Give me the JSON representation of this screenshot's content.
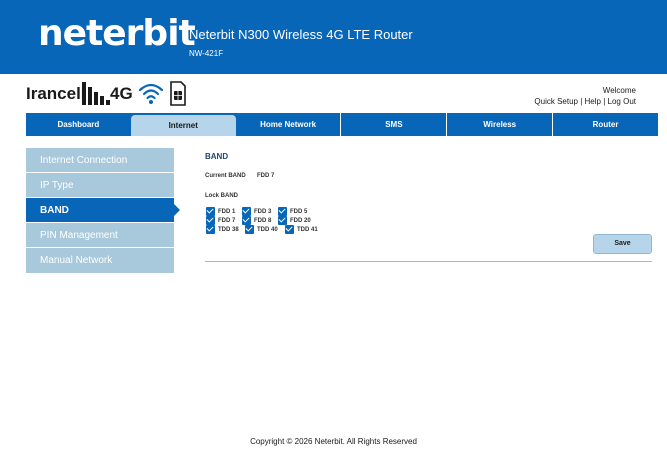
{
  "header": {
    "logo": "neterbit",
    "product_title": "Neterbit N300 Wireless 4G LTE Router",
    "model": "NW-421F"
  },
  "status": {
    "operator": "Irancell",
    "network_type": "4G",
    "signal_level": 5,
    "signal_max": 5
  },
  "user": {
    "welcome": "Welcome",
    "links": [
      "Quick Setup",
      "Help",
      "Log Out"
    ],
    "separator": "|"
  },
  "nav": [
    "Dashboard",
    "Internet",
    "Home Network",
    "SMS",
    "Wireless",
    "Router"
  ],
  "nav_active": "Internet",
  "sidebar": [
    "Internet Connection",
    "IP Type",
    "BAND",
    "PIN Management",
    "Manual Network"
  ],
  "sidebar_active": "BAND",
  "band": {
    "title": "BAND",
    "current_label": "Current BAND",
    "current_value": "FDD 7",
    "lock_label": "Lock BAND",
    "bands": [
      {
        "label": "FDD 1",
        "checked": true
      },
      {
        "label": "FDD 3",
        "checked": true
      },
      {
        "label": "FDD 5",
        "checked": true
      },
      {
        "label": "FDD 7",
        "checked": true
      },
      {
        "label": "FDD 8",
        "checked": true
      },
      {
        "label": "FDD 20",
        "checked": true
      },
      {
        "label": "TDD 38",
        "checked": true
      },
      {
        "label": "TDD 40",
        "checked": true
      },
      {
        "label": "TDD 41",
        "checked": true
      }
    ],
    "save_label": "Save"
  },
  "footer": "Copyright © 2026 Neterbit. All Rights Reserved",
  "colors": {
    "brand": "#0866b8",
    "sidebar": "#a8c8dc",
    "active_tab": "#b6d4ea"
  }
}
